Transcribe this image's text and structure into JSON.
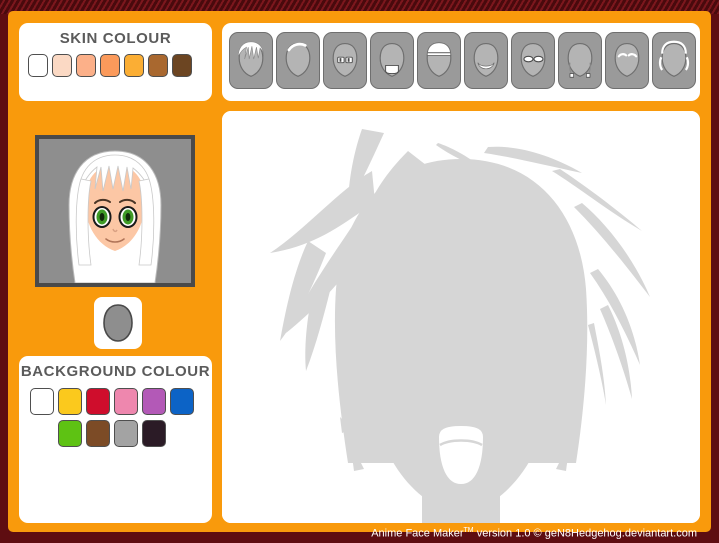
{
  "app": {
    "footer_prefix": "Anime Face Maker",
    "footer_tm": "TM",
    "footer_suffix": " version 1.0 © geN8Hedgehog.deviantart.com",
    "frame_color": "#f99a0c",
    "border_color": "#5e0d11"
  },
  "skin": {
    "title": "SKIN COLOUR",
    "swatches": [
      {
        "name": "white",
        "color": "#ffffff"
      },
      {
        "name": "pale-peach",
        "color": "#fbd9c4"
      },
      {
        "name": "light-peach",
        "color": "#fcb089"
      },
      {
        "name": "tan-orange",
        "color": "#fb9a5b"
      },
      {
        "name": "golden",
        "color": "#fbae34"
      },
      {
        "name": "medium-brown",
        "color": "#a9682f"
      },
      {
        "name": "dark-brown",
        "color": "#6c4522"
      }
    ]
  },
  "background": {
    "title": "BACKGROUND COLOUR",
    "row1": [
      {
        "name": "white",
        "color": "#ffffff"
      },
      {
        "name": "yellow",
        "color": "#fbc91d"
      },
      {
        "name": "crimson",
        "color": "#cf0d2c"
      },
      {
        "name": "pink",
        "color": "#ee87ae"
      },
      {
        "name": "purple",
        "color": "#b359b7"
      },
      {
        "name": "blue",
        "color": "#0c63c6"
      }
    ],
    "row2": [
      {
        "name": "green",
        "color": "#5ec213"
      },
      {
        "name": "brown",
        "color": "#7c4b26"
      },
      {
        "name": "grey",
        "color": "#a3a3a3"
      },
      {
        "name": "black",
        "color": "#2b1b26"
      }
    ]
  },
  "preview": {
    "name": "face-preview",
    "bg_color": "#8e8e8e",
    "skin_color": "#fcc7a5",
    "hair_color": "#ffffff",
    "eye_color": "#3f9b27"
  },
  "parts_toolbar": {
    "buttons": [
      {
        "name": "hair",
        "icon": "hair-icon"
      },
      {
        "name": "head-shape",
        "icon": "head-shape-icon"
      },
      {
        "name": "eyes",
        "icon": "eyes-icon"
      },
      {
        "name": "mouth",
        "icon": "mouth-icon"
      },
      {
        "name": "headband",
        "icon": "headband-icon"
      },
      {
        "name": "smile",
        "icon": "smile-icon"
      },
      {
        "name": "glasses",
        "icon": "glasses-icon"
      },
      {
        "name": "earrings",
        "icon": "earrings-icon"
      },
      {
        "name": "eyebrows",
        "icon": "eyebrows-icon"
      },
      {
        "name": "ears",
        "icon": "ears-icon"
      }
    ]
  },
  "canvas": {
    "name": "main-face-canvas",
    "silhouette_color": "#d6d6d6",
    "bg_color": "#ffffff"
  }
}
